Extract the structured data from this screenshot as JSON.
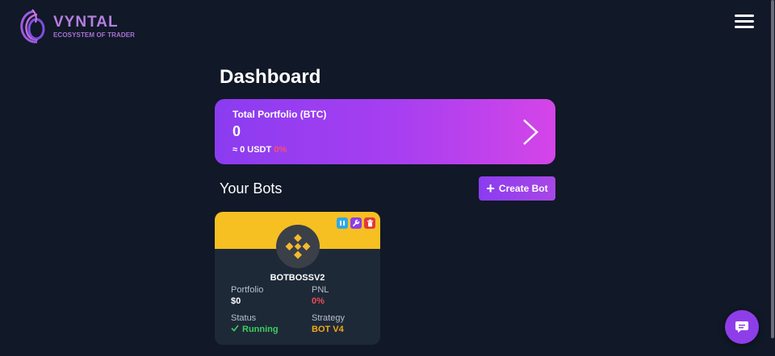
{
  "brand": {
    "name": "VYNTAL",
    "tagline": "ECOSYSTEM OF TRADER"
  },
  "dashboard": {
    "title": "Dashboard"
  },
  "portfolio": {
    "label": "Total Portfolio (BTC)",
    "value": "0",
    "usdt": "≈ 0 USDT",
    "change": "0%"
  },
  "bots": {
    "title": "Your Bots",
    "create_label": "Create Bot",
    "items": [
      {
        "name": "BOTBOSSV2",
        "portfolio_label": "Portfolio",
        "portfolio_value": "$0",
        "pnl_label": "PNL",
        "pnl_value": "0%",
        "status_label": "Status",
        "status_value": "Running",
        "strategy_label": "Strategy",
        "strategy_value": "BOT V4",
        "exchange_icon": "binance-icon"
      }
    ]
  },
  "colors": {
    "background": "#111827",
    "accent": "#8e3ee8",
    "card_header": "#f6c022",
    "negative": "#ef4b55",
    "positive": "#3ccf5e",
    "strategy": "#f0a818"
  }
}
